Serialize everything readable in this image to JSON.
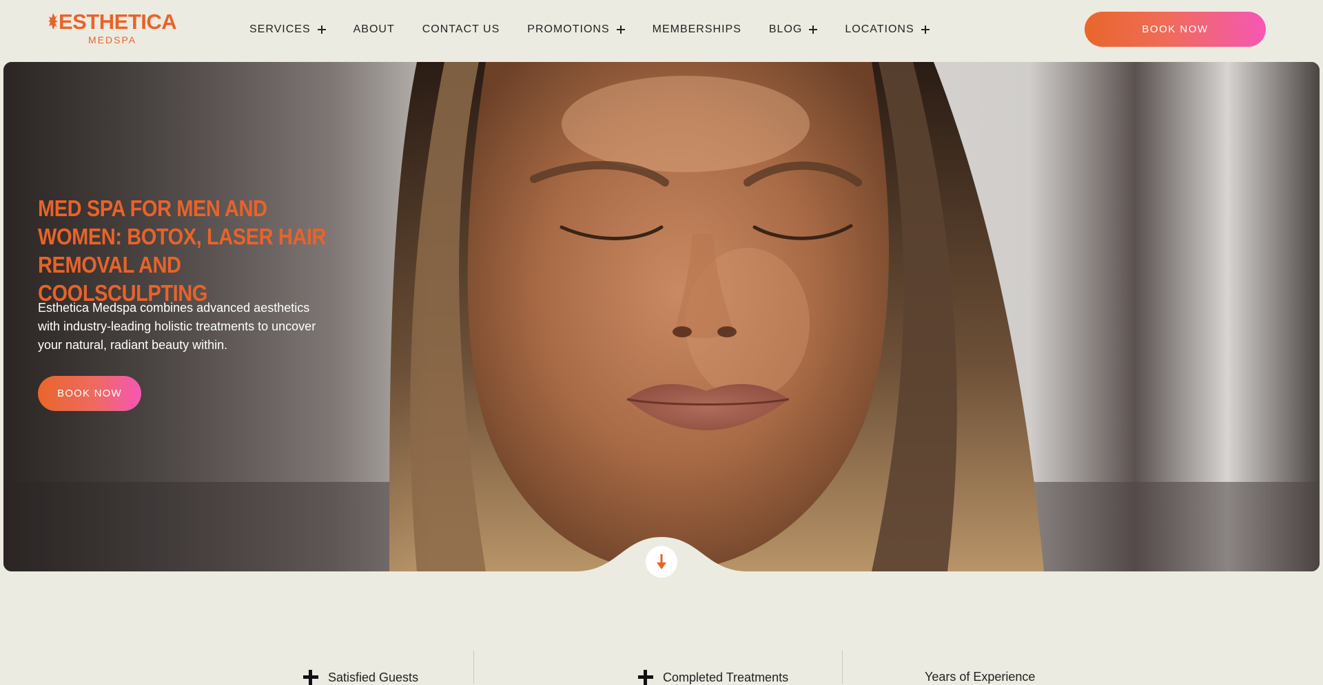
{
  "brand": {
    "name": "ESTHETICA",
    "sub": "MEDSPA",
    "accent": "#e8632a",
    "gradient_end": "#f657b5"
  },
  "nav": {
    "items": [
      {
        "label": "SERVICES",
        "has_plus": true
      },
      {
        "label": "ABOUT",
        "has_plus": false
      },
      {
        "label": "CONTACT US",
        "has_plus": false
      },
      {
        "label": "PROMOTIONS",
        "has_plus": true
      },
      {
        "label": "MEMBERSHIPS",
        "has_plus": false
      },
      {
        "label": "BLOG",
        "has_plus": true
      },
      {
        "label": "LOCATIONS",
        "has_plus": true
      }
    ],
    "book_label": "BOOK NOW"
  },
  "hero": {
    "title": "MED SPA FOR MEN AND WOMEN: BOTOX, LASER HAIR REMOVAL AND COOLSCULPTING",
    "subtitle": "Esthetica Medspa combines advanced aesthetics with industry-leading holistic treatments to uncover your natural, radiant beauty within.",
    "book_label": "BOOK NOW",
    "scroll_icon": "arrow-down-icon"
  },
  "stats": [
    {
      "label": "Satisfied Guests",
      "has_plus": true
    },
    {
      "label": "Completed Treatments",
      "has_plus": true
    },
    {
      "label": "Years of Experience",
      "has_plus": false
    }
  ]
}
